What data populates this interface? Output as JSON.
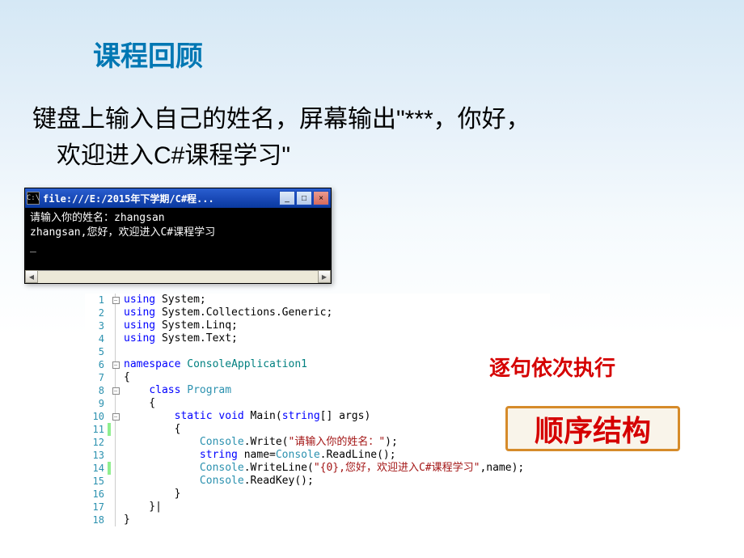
{
  "title": "课程回顾",
  "subtitle_line1": "键盘上输入自己的姓名，屏幕输出\"***，你好，",
  "subtitle_line2": "欢迎进入C#课程学习\"",
  "console": {
    "titlebar_icon": "C:\\",
    "titlebar_text": "file:///E:/2015年下学期/C#程...",
    "min_btn": "_",
    "max_btn": "□",
    "close_btn": "×",
    "output_line1": "请输入你的姓名：zhangsan",
    "output_line2": "zhangsan,您好，欢迎进入C#课程学习",
    "scroll_left": "◀",
    "scroll_right": "▶"
  },
  "label_inline": "逐句依次执行",
  "badge_text": "顺序结构",
  "code": {
    "l1": {
      "no": "1",
      "fold": "⊟",
      "kw": "using",
      "rest": " System;",
      "hl": false
    },
    "l2": {
      "no": "2",
      "kw": "using",
      "rest": " System.Collections.Generic;",
      "hl": false
    },
    "l3": {
      "no": "3",
      "kw": "using",
      "rest": " System.Linq;",
      "hl": false
    },
    "l4": {
      "no": "4",
      "kw": "using",
      "rest": " System.Text;",
      "hl": false
    },
    "l5": {
      "no": "5"
    },
    "l6": {
      "no": "6",
      "fold": "⊟",
      "kw": "namespace",
      "nsname": " ConsoleApplication1",
      "hl": false
    },
    "l7": {
      "no": "7",
      "text": "{"
    },
    "l8": {
      "no": "8",
      "fold": "⊟",
      "indent": "    ",
      "kw": "class",
      "cls": " Program"
    },
    "l9": {
      "no": "9",
      "text": "    {"
    },
    "l10": {
      "no": "10",
      "fold": "⊟",
      "indent": "        ",
      "kw1": "static",
      "kw2": " void",
      "m": " Main(",
      "kw3": "string",
      "m2": "[] args)"
    },
    "l11": {
      "no": "11",
      "hl": true,
      "text": "        {"
    },
    "l12": {
      "no": "12",
      "indent": "            ",
      "cls": "Console",
      "m": ".Write(",
      "str": "\"请输入你的姓名：\"",
      "m2": ");"
    },
    "l13": {
      "no": "13",
      "indent": "            ",
      "kw": "string",
      "m": " name=",
      "cls": "Console",
      "m2": ".ReadLine();"
    },
    "l14": {
      "no": "14",
      "hl": true,
      "indent": "            ",
      "cls": "Console",
      "m": ".WriteLine(",
      "str": "\"{0},您好，欢迎进入C#课程学习\"",
      "m2": ",name);"
    },
    "l15": {
      "no": "15",
      "indent": "            ",
      "cls": "Console",
      "m": ".ReadKey();"
    },
    "l16": {
      "no": "16",
      "text": "        }"
    },
    "l17": {
      "no": "17",
      "text": "    }|"
    },
    "l18": {
      "no": "18",
      "text": "}"
    }
  }
}
